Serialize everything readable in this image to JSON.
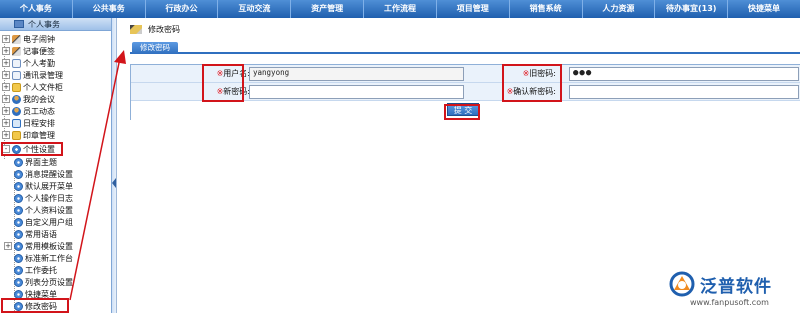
{
  "topnav": [
    "个人事务",
    "公共事务",
    "行政办公",
    "互动交流",
    "资产管理",
    "工作流程",
    "项目管理",
    "销售系统",
    "人力资源",
    "待办事宜(13)",
    "快捷菜单"
  ],
  "sidebar": {
    "title": "个人事务",
    "items": [
      {
        "label": "电子闹钟",
        "icon": "alarm-icon"
      },
      {
        "label": "记事便签",
        "icon": "note-icon"
      },
      {
        "label": "个人考勤",
        "icon": "attendance-icon"
      },
      {
        "label": "通讯录管理",
        "icon": "contacts-icon"
      },
      {
        "label": "个人文件柜",
        "icon": "folder-icon"
      },
      {
        "label": "我的会议",
        "icon": "meeting-icon"
      },
      {
        "label": "员工动态",
        "icon": "staff-icon"
      },
      {
        "label": "日程安排",
        "icon": "calendar-icon"
      },
      {
        "label": "印章管理",
        "icon": "seal-icon"
      },
      {
        "label": "个性设置",
        "icon": "gear-icon"
      }
    ],
    "subitems": [
      "界面主题",
      "消息提醒设置",
      "默认展开菜单",
      "个人操作日志",
      "个人资料设置",
      "自定义用户组",
      "常用语语",
      "常用模板设置",
      "标准新工作台",
      "工作委托",
      "列表分页设置",
      "快捷菜单",
      "修改密码"
    ]
  },
  "page": {
    "title": "修改密码",
    "tab": "修改密码"
  },
  "form": {
    "username_label": "用户名:",
    "username_value": "yangyong",
    "old_password_label": "旧密码:",
    "old_password_value": "●●●",
    "new_password_label": "新密码:",
    "new_password_value": "",
    "confirm_password_label": "确认新密码:",
    "confirm_password_value": "",
    "required_mark": "※",
    "submit_label": "提 交"
  },
  "brand": {
    "name": "泛普软件",
    "url": "www.fanpusoft.com"
  },
  "colors": {
    "nav": "#1f5fae",
    "highlight": "#d2141a"
  }
}
